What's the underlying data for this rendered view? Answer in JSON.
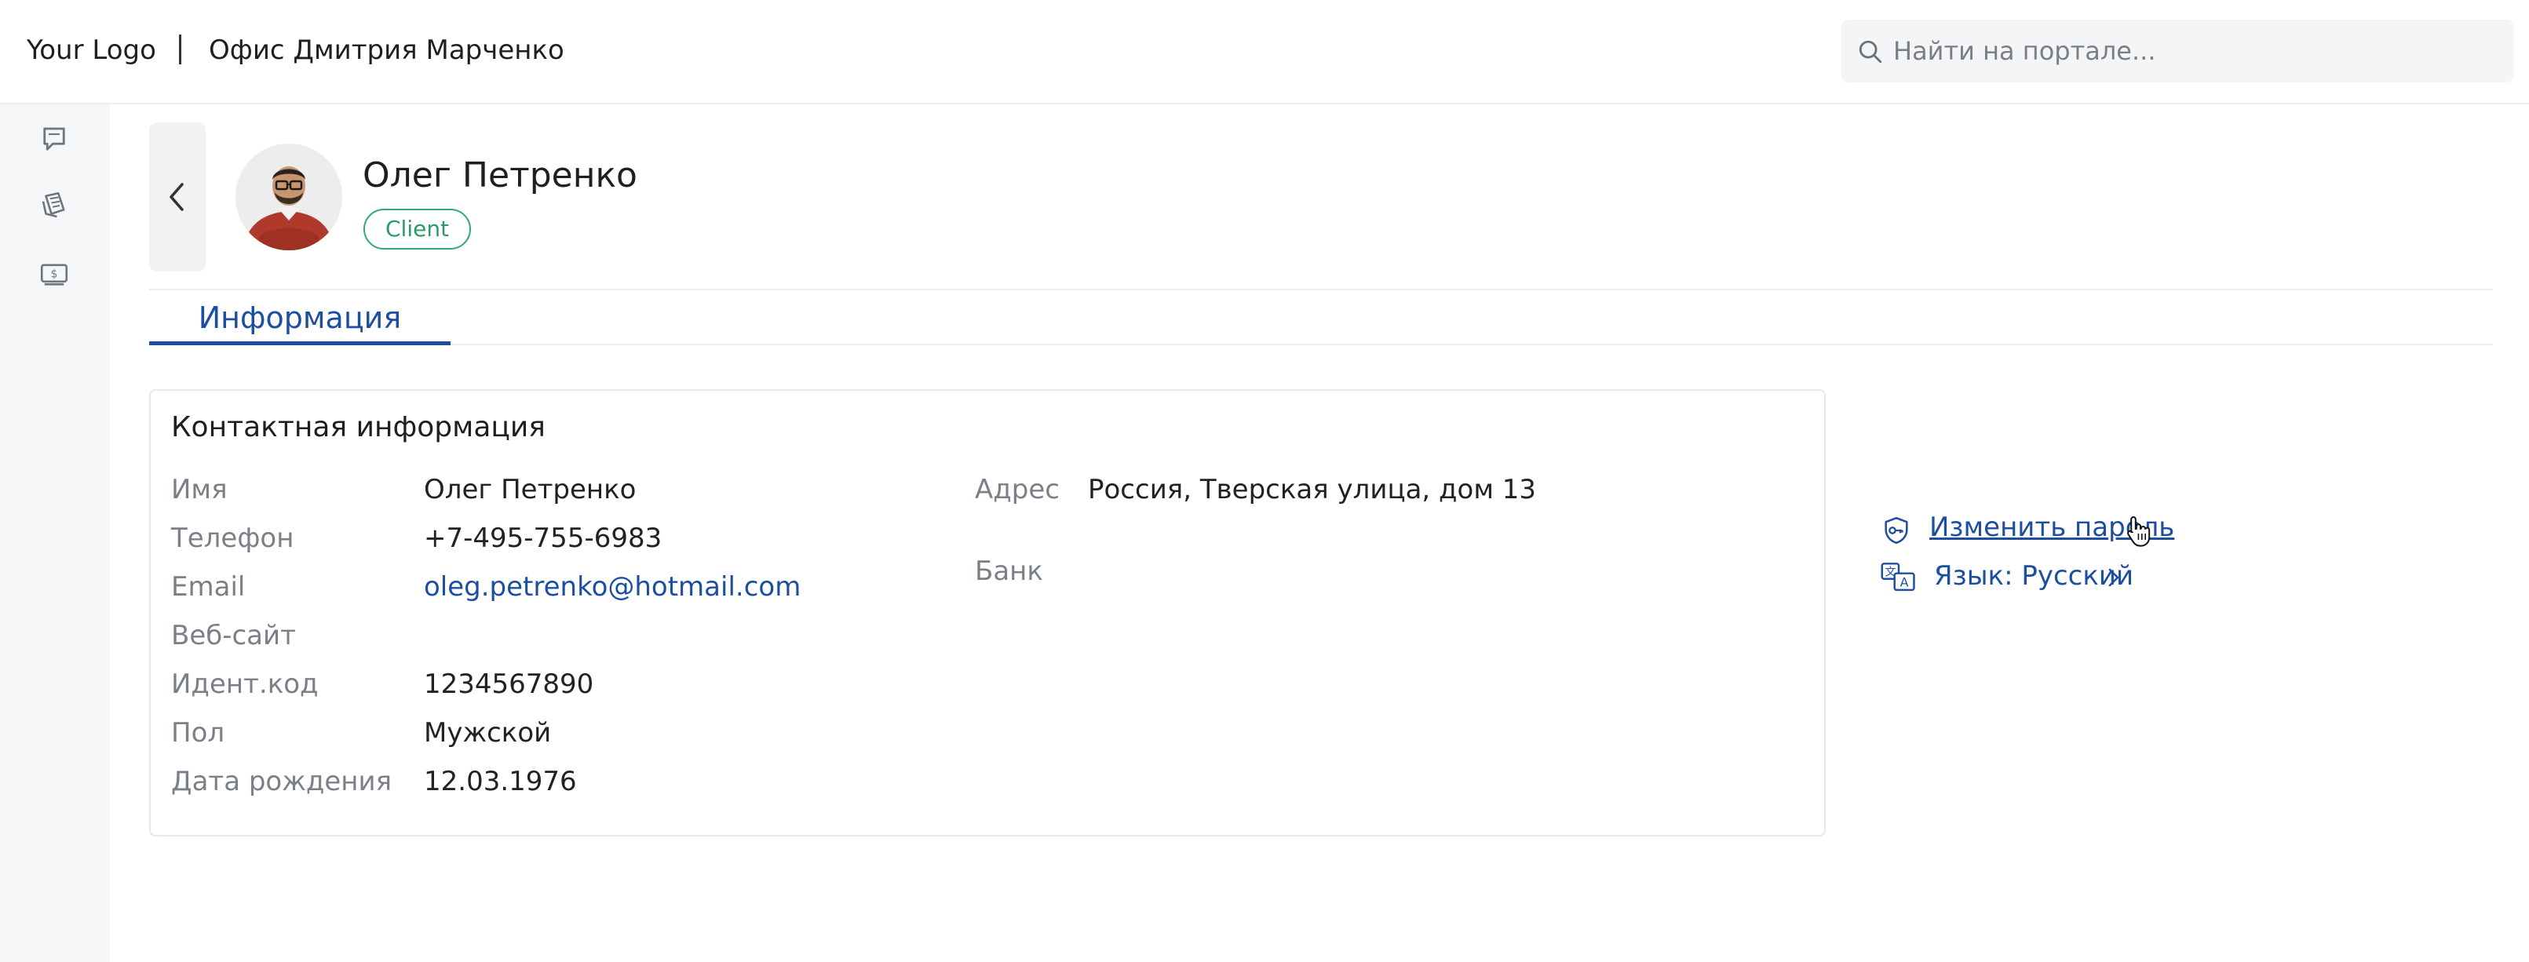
{
  "header": {
    "logo": "Your Logo",
    "office_title": "Офис Дмитрия Марченко",
    "search_placeholder": "Найти на портале..."
  },
  "rail": {
    "icons": [
      "chat-icon",
      "tickets-icon",
      "billing-icon"
    ]
  },
  "profile": {
    "name": "Олег Петренко",
    "role": "Client"
  },
  "tabs": [
    {
      "label": "Информация",
      "active": true
    }
  ],
  "contact": {
    "title": "Контактная информация",
    "fields": [
      {
        "label": "Имя",
        "value": "Олег Петренко"
      },
      {
        "label": "Телефон",
        "value": "+7-495-755-6983"
      },
      {
        "label": "Email",
        "value": "oleg.petrenko@hotmail.com"
      },
      {
        "label": "Веб-сайт",
        "value": ""
      },
      {
        "label": "Идент.код",
        "value": "1234567890"
      },
      {
        "label": "Пол",
        "value": "Мужской"
      },
      {
        "label": "Дата рождения",
        "value": "12.03.1976"
      }
    ],
    "right_fields": [
      {
        "label": "Адрес",
        "value": "Россия, Тверская улица, дом 13"
      },
      {
        "label": "Банк",
        "value": ""
      }
    ]
  },
  "actions": {
    "change_password": "Изменить пароль",
    "language": "Язык: Русский"
  },
  "colors": {
    "accent": "#1c4fa0",
    "badge_green": "#2eaa74",
    "rail_bg": "#f5f6f8"
  }
}
